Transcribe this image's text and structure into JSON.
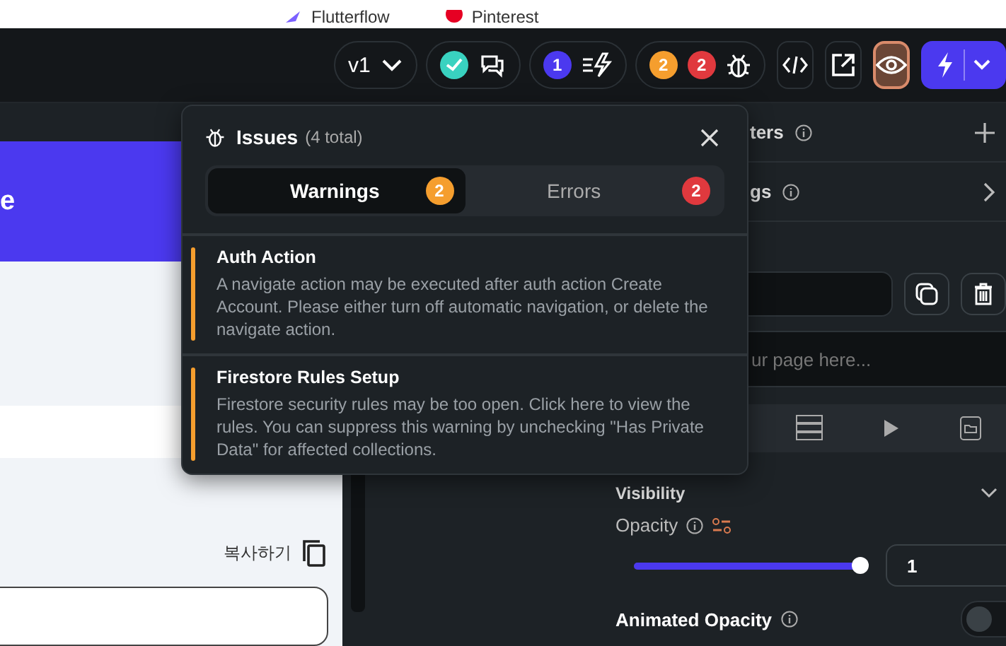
{
  "bookmarks": [
    {
      "label": "Flutterflow"
    },
    {
      "label": "Pinterest"
    }
  ],
  "toolbar": {
    "version": "v1",
    "comments_badge": {
      "kind": "check"
    },
    "actions_count": "1",
    "warnings_count": "2",
    "errors_count": "2"
  },
  "canvas": {
    "header_text": "e",
    "copy_label": "복사하기"
  },
  "right_panel": {
    "parameters_label": "ters",
    "settings_label": "gs",
    "description_placeholder": "ur page here...",
    "visibility_label": "Visibility",
    "opacity_label": "Opacity",
    "opacity": {
      "level": 1.0,
      "value": "1"
    },
    "animated_opacity": {
      "label": "Animated Opacity",
      "on": false
    }
  },
  "issues_popup": {
    "title": "Issues",
    "total": "(4 total)",
    "tabs": [
      {
        "label": "Warnings",
        "count": "2",
        "kind": "warning",
        "selected": true
      },
      {
        "label": "Errors",
        "count": "2",
        "kind": "error",
        "selected": false
      }
    ],
    "issues": [
      {
        "title": "Auth Action",
        "message": "A navigate action may be executed after auth action Create Account. Please either turn off automatic navigation, or delete the navigate action."
      },
      {
        "title": "Firestore Rules Setup",
        "message": "Firestore security rules may be too open. Click here to view the rules. You can suppress this warning by unchecking \"Has Private Data\" for affected collections."
      }
    ]
  }
}
